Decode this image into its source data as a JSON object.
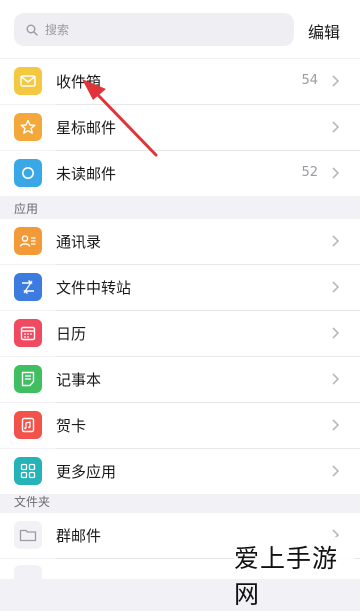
{
  "search": {
    "placeholder": "搜索"
  },
  "header": {
    "edit_label": "编辑"
  },
  "mailboxes": [
    {
      "label": "收件箱",
      "count": "54",
      "icon": "inbox-icon",
      "color": "#f5c842"
    },
    {
      "label": "星标邮件",
      "count": "",
      "icon": "star-icon",
      "color": "#f2a83a"
    },
    {
      "label": "未读邮件",
      "count": "52",
      "icon": "circle-icon",
      "color": "#3aa8e6"
    }
  ],
  "apps_section": {
    "title": "应用"
  },
  "apps": [
    {
      "label": "通讯录",
      "icon": "contacts-icon",
      "color": "#f29a38"
    },
    {
      "label": "文件中转站",
      "icon": "transfer-icon",
      "color": "#3c7be0"
    },
    {
      "label": "日历",
      "icon": "calendar-icon",
      "color": "#ef4a5f"
    },
    {
      "label": "记事本",
      "icon": "notes-icon",
      "color": "#3fbf62"
    },
    {
      "label": "贺卡",
      "icon": "card-icon",
      "color": "#f2524a"
    },
    {
      "label": "更多应用",
      "icon": "grid-icon",
      "color": "#26b3b8"
    }
  ],
  "folders_section": {
    "title": "文件夹"
  },
  "folders": [
    {
      "label": "群邮件",
      "icon": "folder-icon"
    }
  ],
  "annotation": {
    "arrow_color": "#e0343a"
  },
  "watermark": {
    "text": "爱上手游网"
  }
}
